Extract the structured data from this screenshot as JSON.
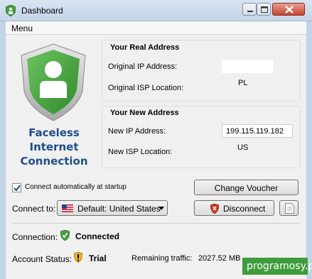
{
  "window": {
    "title": "Dashboard"
  },
  "menu": {
    "items": [
      {
        "label": "Menu"
      }
    ]
  },
  "brand": {
    "line1": "Faceless",
    "line2": "Internet",
    "line3": "Connection"
  },
  "real_address": {
    "title": "Your Real Address",
    "ip_label": "Original IP Address:",
    "ip_value": "",
    "isp_label": "Original ISP Location:",
    "isp_value": "PL"
  },
  "new_address": {
    "title": "Your New Address",
    "ip_label": "New IP Address:",
    "ip_value": "199.115.119.182",
    "isp_label": "New ISP Location:",
    "isp_value": "US"
  },
  "settings": {
    "auto_connect_label": "Connect automatically at startup",
    "auto_connect_checked": true,
    "connect_to_label": "Connect to:",
    "connect_to_value": "Default: United States"
  },
  "buttons": {
    "change_voucher": "Change Voucher",
    "disconnect": "Disconnect"
  },
  "status": {
    "connection_label": "Connection:",
    "connection_value": "Connected",
    "account_label": "Account Status:",
    "account_value": "Trial",
    "traffic_label": "Remaining traffic:",
    "traffic_value": "2027.52",
    "traffic_unit": "MB"
  },
  "watermark": "programosy.pl",
  "colors": {
    "brand_blue": "#1f4e8a",
    "shield_green": "#4aa23f",
    "watermark_green": "#3f9c3b"
  }
}
